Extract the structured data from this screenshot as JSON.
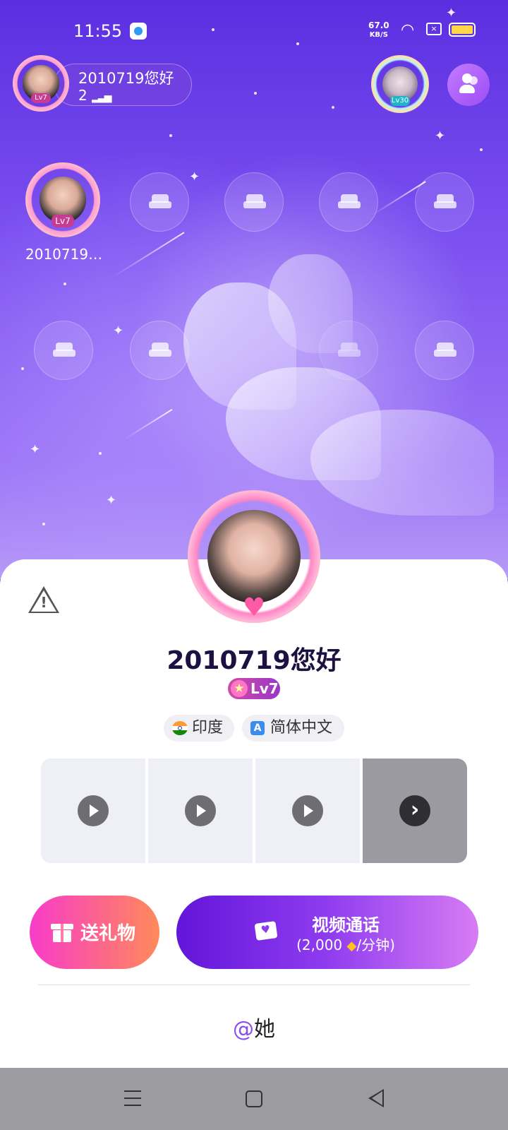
{
  "status_bar": {
    "time": "11:55",
    "net_speed": "67.0",
    "net_unit": "KB/S"
  },
  "room": {
    "name": "2010719您好",
    "online_count": "2",
    "host_level": "Lv7",
    "top_user_level": "Lv30"
  },
  "seats": {
    "occupied_name": "2010719…",
    "occupied_level": "Lv7"
  },
  "profile": {
    "name": "2010719您好",
    "level": "Lv7",
    "country": "印度",
    "language": "简体中文"
  },
  "actions": {
    "gift_label": "送礼物",
    "call_title": "视频通话",
    "call_price_prefix": "(2,000",
    "call_price_suffix": "/分钟)",
    "mention_at": "@",
    "mention_text": "她"
  },
  "colors": {
    "accent_purple": "#8a4bf0",
    "gift_gradient_start": "#f93cc9",
    "gift_gradient_end": "#ff8a5a",
    "call_gradient_start": "#6315d9",
    "call_gradient_end": "#d77cf4"
  },
  "icons": {
    "report": "warning-icon",
    "play": "play-icon",
    "more": "chevron-right-icon",
    "gift": "gift-icon",
    "video": "video-camera-icon",
    "people": "people-icon",
    "seat": "sofa-icon"
  }
}
